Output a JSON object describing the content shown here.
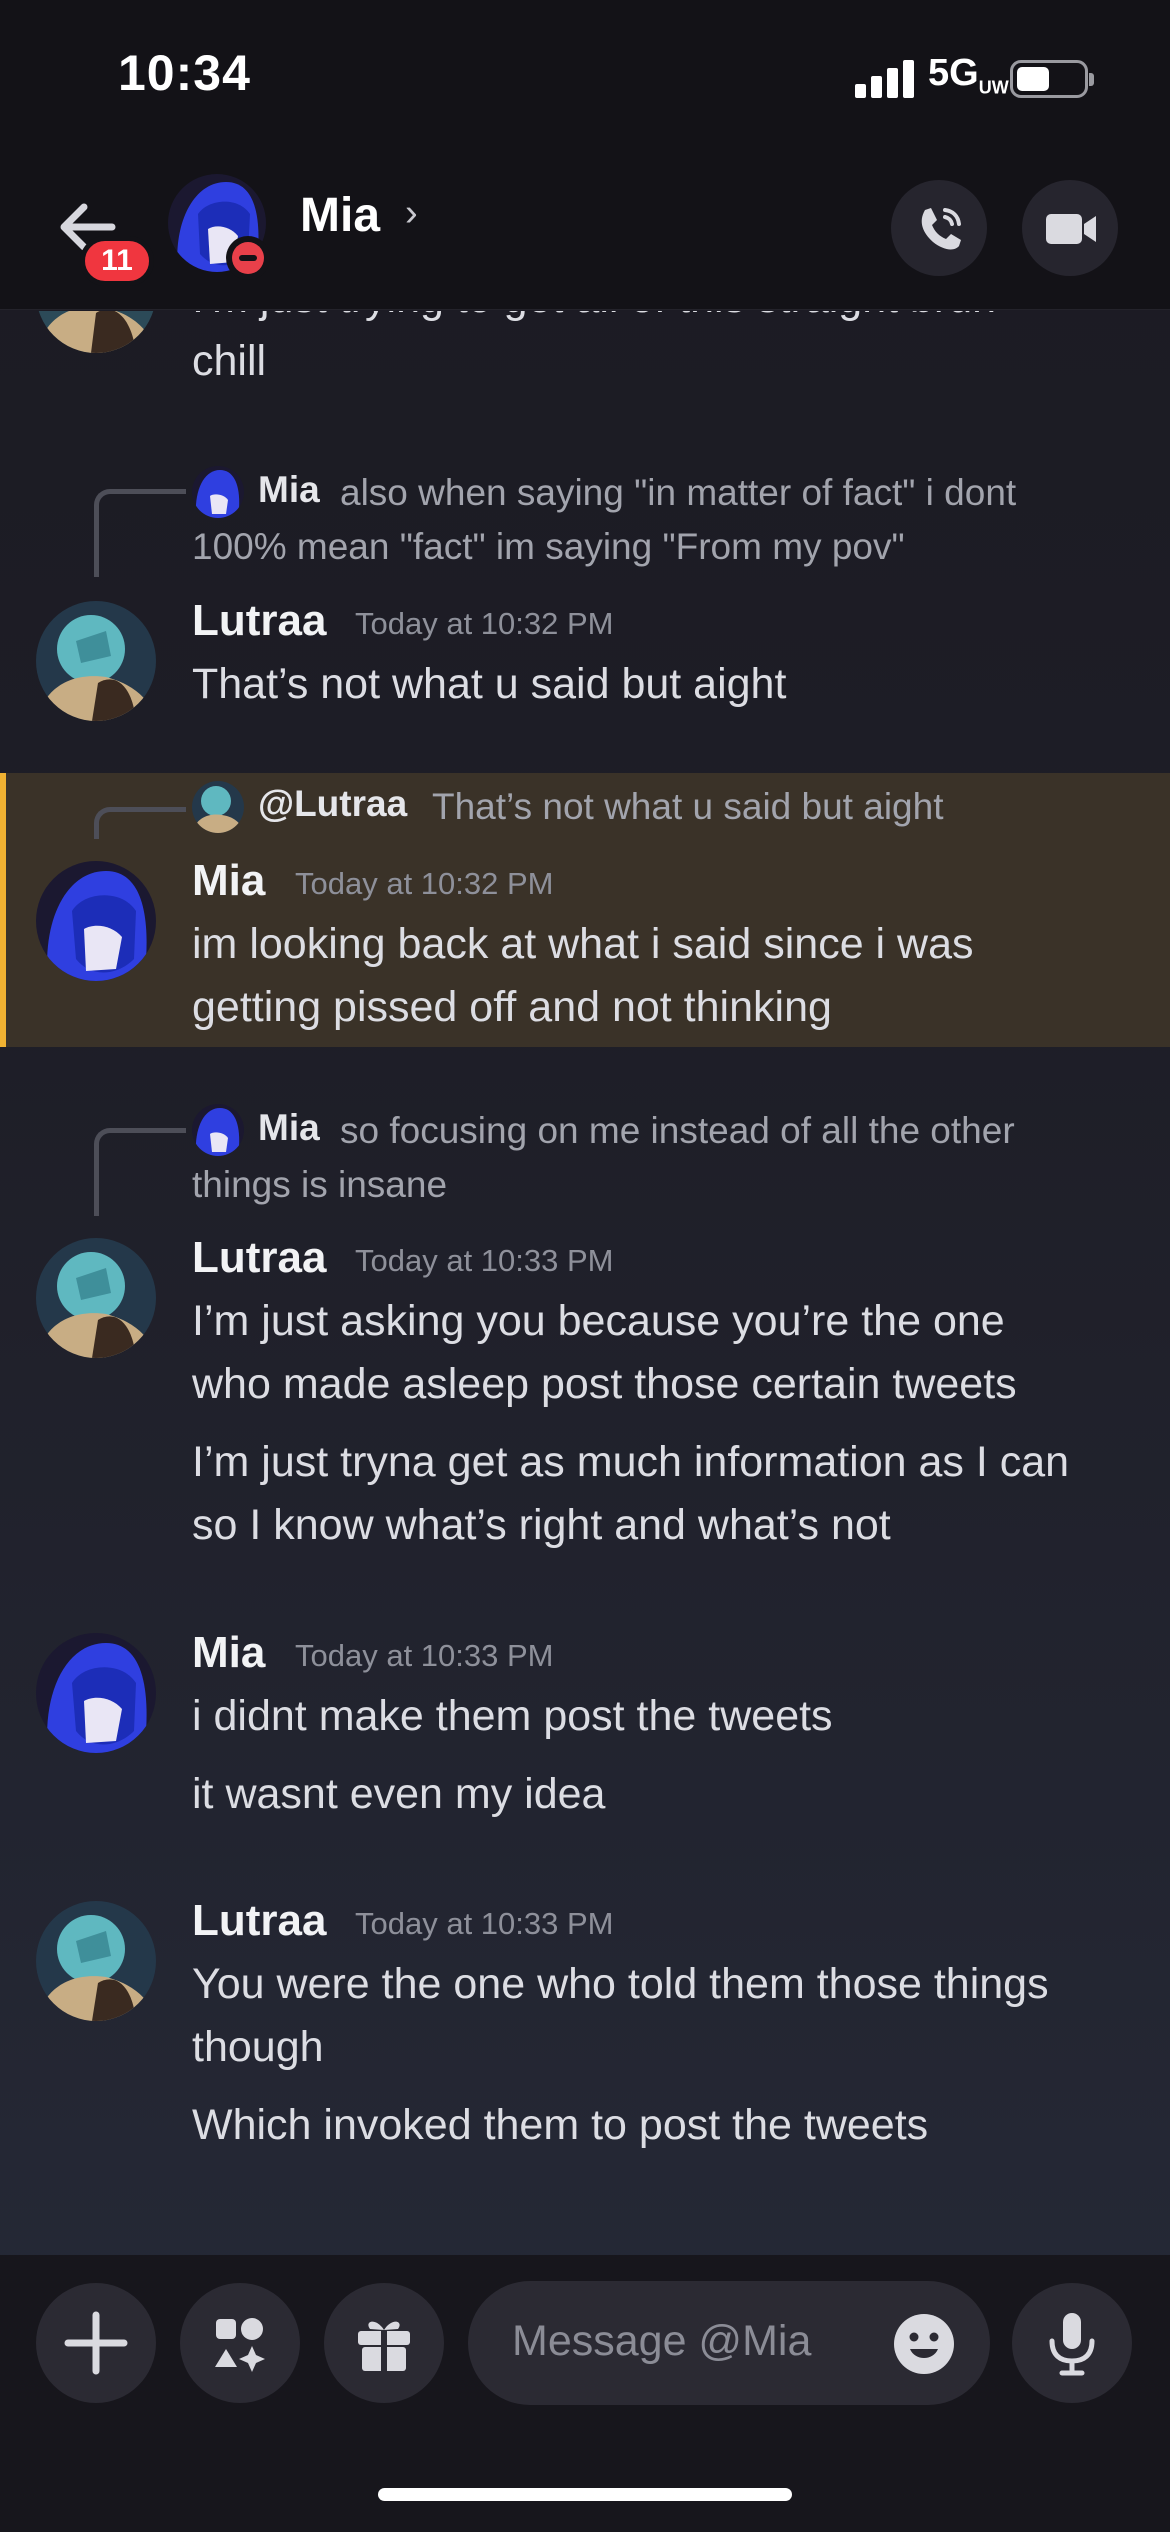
{
  "status": {
    "time": "10:34",
    "network": "5G",
    "network_sub": "UW"
  },
  "header": {
    "back_badge": "11",
    "name": "Mia",
    "chevron": "›"
  },
  "colors": {
    "highlight_bg": "#3a3228",
    "highlight_bar": "#f0b232",
    "badge": "#f0363f",
    "dnd": "#e8404a"
  },
  "messages": {
    "m0": {
      "lines": [
        "I'm just trying to get all of this straight bruh",
        "chill"
      ]
    },
    "m1": {
      "reply": {
        "name": "Mia",
        "text_l1": "also when saying \"in matter of fact\" i dont",
        "text_l2": "100% mean \"fact\" im saying \"From my pov\""
      },
      "user": "Lutraa",
      "time": "Today at 10:32 PM",
      "lines": [
        "That’s not what u said but aight"
      ]
    },
    "m2": {
      "reply": {
        "name": "@Lutraa",
        "text_l1": "That’s not what u said but aight"
      },
      "user": "Mia",
      "time": "Today at 10:32 PM",
      "lines": [
        "im looking back at what i said since i was",
        "getting pissed off and not thinking"
      ]
    },
    "m3": {
      "reply": {
        "name": "Mia",
        "text_l1": "so focusing on me instead of all the other",
        "text_l2": "things is insane"
      },
      "user": "Lutraa",
      "time": "Today at 10:33 PM",
      "lines": [
        "I’m just asking you because you’re the one",
        "who made asleep post those certain tweets"
      ],
      "lines2": [
        "I’m just tryna get as much information as I can",
        "so I know what’s right and what’s not"
      ]
    },
    "m4": {
      "user": "Mia",
      "time": "Today at 10:33 PM",
      "lines": [
        "i didnt make them post the tweets"
      ],
      "lines2": [
        "it wasnt even my idea"
      ]
    },
    "m5": {
      "user": "Lutraa",
      "time": "Today at 10:33 PM",
      "lines": [
        "You were the one who told them those things",
        "though"
      ],
      "lines2": [
        "Which invoked them to post the tweets"
      ]
    }
  },
  "composer": {
    "placeholder": "Message @Mia"
  },
  "icons": {
    "back": "back-arrow-icon",
    "call": "phone-icon",
    "video": "video-camera-icon",
    "plus": "plus-icon",
    "apps": "apps-icon",
    "gift": "gift-icon",
    "emoji": "emoji-icon",
    "mic": "microphone-icon"
  }
}
